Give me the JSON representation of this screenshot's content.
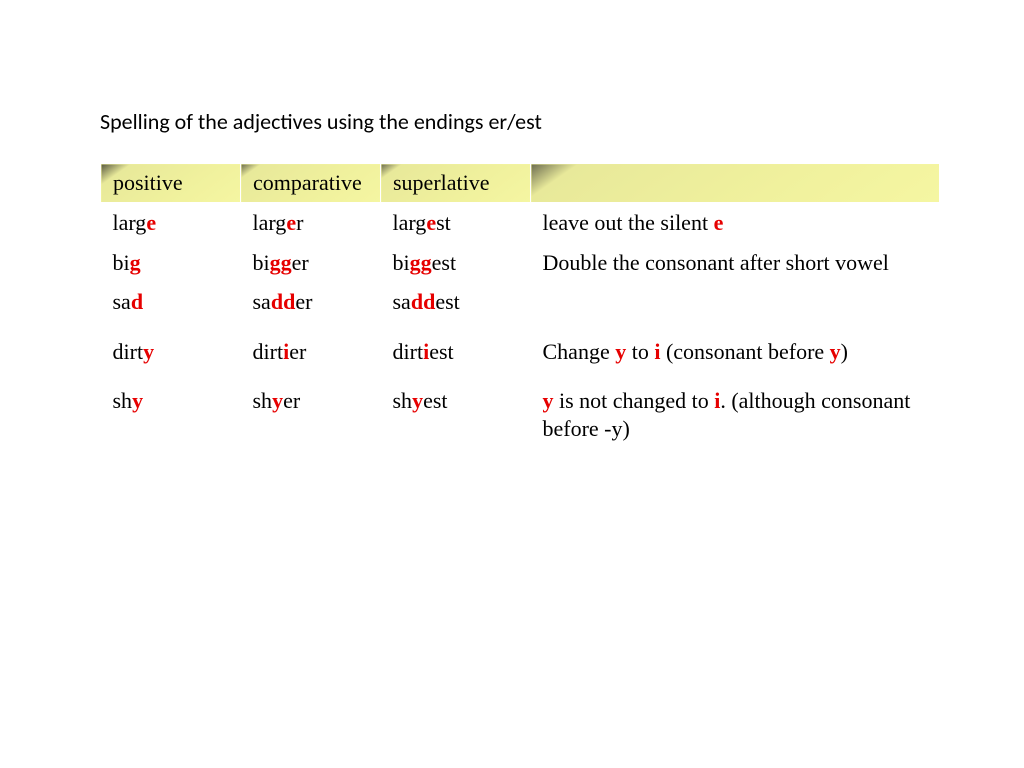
{
  "title": "Spelling of the adjectives using the endings er/est",
  "headers": {
    "positive": "positive",
    "comparative": "comparative",
    "superlative": "superlative",
    "rule": ""
  },
  "rows": [
    {
      "positive": [
        {
          "t": "larg"
        },
        {
          "t": "e",
          "hl": true
        }
      ],
      "comparative": [
        {
          "t": "larg"
        },
        {
          "t": "e",
          "hl": true
        },
        {
          "t": "r"
        }
      ],
      "superlative": [
        {
          "t": "larg"
        },
        {
          "t": "e",
          "hl": true
        },
        {
          "t": "st"
        }
      ],
      "rule": [
        {
          "t": "leave out the silent "
        },
        {
          "t": "e",
          "hl": true
        }
      ],
      "cls": "tight"
    },
    {
      "positive": [
        {
          "t": "bi"
        },
        {
          "t": "g",
          "hl": true
        }
      ],
      "comparative": [
        {
          "t": "bi"
        },
        {
          "t": "gg",
          "hl": true
        },
        {
          "t": "er"
        }
      ],
      "superlative": [
        {
          "t": "bi"
        },
        {
          "t": "gg",
          "hl": true
        },
        {
          "t": "est"
        }
      ],
      "rule": [
        {
          "t": "Double the consonant after short vowel"
        }
      ],
      "cls": "tight",
      "rowspanRule": 2
    },
    {
      "positive": [
        {
          "t": "sa"
        },
        {
          "t": "d",
          "hl": true
        }
      ],
      "comparative": [
        {
          "t": "sa"
        },
        {
          "t": "dd",
          "hl": true
        },
        {
          "t": "er"
        }
      ],
      "superlative": [
        {
          "t": "sa"
        },
        {
          "t": "dd",
          "hl": true
        },
        {
          "t": "est"
        }
      ],
      "cls": "tight"
    },
    {
      "positive": [
        {
          "t": "dirt"
        },
        {
          "t": "y",
          "hl": true
        }
      ],
      "comparative": [
        {
          "t": "dirt"
        },
        {
          "t": "i",
          "hl": true
        },
        {
          "t": "er"
        }
      ],
      "superlative": [
        {
          "t": "dirt"
        },
        {
          "t": "i",
          "hl": true
        },
        {
          "t": "est"
        }
      ],
      "rule": [
        {
          "t": "Change "
        },
        {
          "t": "y",
          "hl": true
        },
        {
          "t": " to "
        },
        {
          "t": "i",
          "hl": true
        },
        {
          "t": " (consonant before "
        },
        {
          "t": "y",
          "hl": true
        },
        {
          "t": ")"
        }
      ],
      "cls": "loose"
    },
    {
      "positive": [
        {
          "t": "sh"
        },
        {
          "t": "y",
          "hl": true
        }
      ],
      "comparative": [
        {
          "t": "sh"
        },
        {
          "t": "y",
          "hl": true
        },
        {
          "t": "er"
        }
      ],
      "superlative": [
        {
          "t": "sh"
        },
        {
          "t": "y",
          "hl": true
        },
        {
          "t": "est"
        }
      ],
      "rule": [
        {
          "t": "y",
          "hl": true
        },
        {
          "t": " is not changed to "
        },
        {
          "t": "i",
          "hl": true
        },
        {
          "t": ". (although consonant before -y)"
        }
      ],
      "cls": "loose"
    }
  ]
}
